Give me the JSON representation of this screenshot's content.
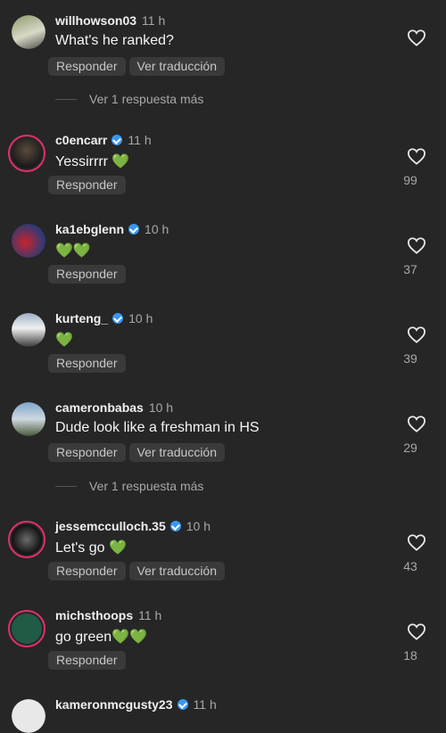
{
  "comments": [
    {
      "user": "willhowson03",
      "time": "11 h",
      "text": "What's he ranked?",
      "reply": "Responder",
      "translate": "Ver traducción",
      "likes": ""
    },
    {
      "user": "c0encarr",
      "time": "11 h",
      "text": "Yessirrrr 💚",
      "reply": "Responder",
      "likes": "99"
    },
    {
      "user": "ka1ebglenn",
      "time": "10 h",
      "text": "💚💚",
      "reply": "Responder",
      "likes": "37"
    },
    {
      "user": "kurteng_",
      "time": "10 h",
      "text": "💚",
      "reply": "Responder",
      "likes": "39"
    },
    {
      "user": "cameronbabas",
      "time": "10 h",
      "text": "Dude look like a freshman in HS",
      "reply": "Responder",
      "translate": "Ver traducción",
      "likes": "29"
    },
    {
      "user": "jessemcculloch.35",
      "time": "10 h",
      "text": "Let's go 💚",
      "reply": "Responder",
      "translate": "Ver traducción",
      "likes": "43"
    },
    {
      "user": "michsthoops",
      "time": "11 h",
      "text": "go green💚💚",
      "reply": "Responder",
      "likes": "18"
    },
    {
      "user": "kameronmcgusty23",
      "time": "11 h",
      "text": ""
    }
  ],
  "more_replies": [
    "Ver 1 respuesta más",
    "Ver 1 respuesta más"
  ],
  "colors": {
    "background": "#262626",
    "verified": "#3897f0",
    "story_ring": "#e1306c",
    "pill": "#3a3a3a"
  },
  "icons": {
    "like": "heart-outline-icon",
    "verified": "verified-badge-icon"
  }
}
